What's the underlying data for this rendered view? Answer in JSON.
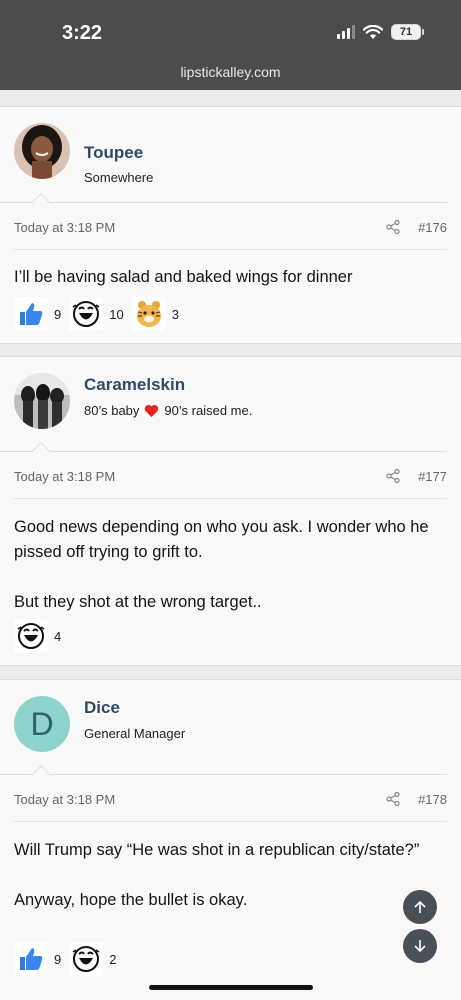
{
  "status_bar": {
    "time": "3:22",
    "battery": "71"
  },
  "browser": {
    "url": "lipstickalley.com"
  },
  "posts": [
    {
      "username": "Toupee",
      "user_title": "Somewhere",
      "date": "Today at 3:18 PM",
      "post_number": "#176",
      "message": [
        "I’ll be having salad and baked wings for dinner"
      ],
      "reactions": [
        {
          "icon": "thumbs-up-icon",
          "count": "9"
        },
        {
          "icon": "laughing-face-icon",
          "count": "10"
        },
        {
          "icon": "tiger-icon",
          "count": "3"
        }
      ]
    },
    {
      "username": "Caramelskin",
      "user_title_before": "80’s baby",
      "user_title_after": "90’s raised me.",
      "user_title_icon": "heart-icon",
      "date": "Today at 3:18 PM",
      "post_number": "#177",
      "message": [
        "Good news depending on who you ask. I wonder who he pissed off trying to grift to.",
        "But they shot at the wrong target.."
      ],
      "reactions": [
        {
          "icon": "laughing-face-icon",
          "count": "4"
        }
      ]
    },
    {
      "username": "Dice",
      "user_title": "General Manager",
      "avatar_letter": "D",
      "date": "Today at 3:18 PM",
      "post_number": "#178",
      "message": [
        "Will Trump say “He was shot in a republican city/state?”",
        "Anyway, hope the bullet is okay."
      ],
      "reactions": [
        {
          "icon": "thumbs-up-icon",
          "count": "9"
        },
        {
          "icon": "laughing-face-icon",
          "count": "2"
        }
      ]
    }
  ],
  "colors": {
    "username": "#2f4a66",
    "topbar": "#4a4d4b",
    "avatar_dice": "#8fd3cf"
  }
}
